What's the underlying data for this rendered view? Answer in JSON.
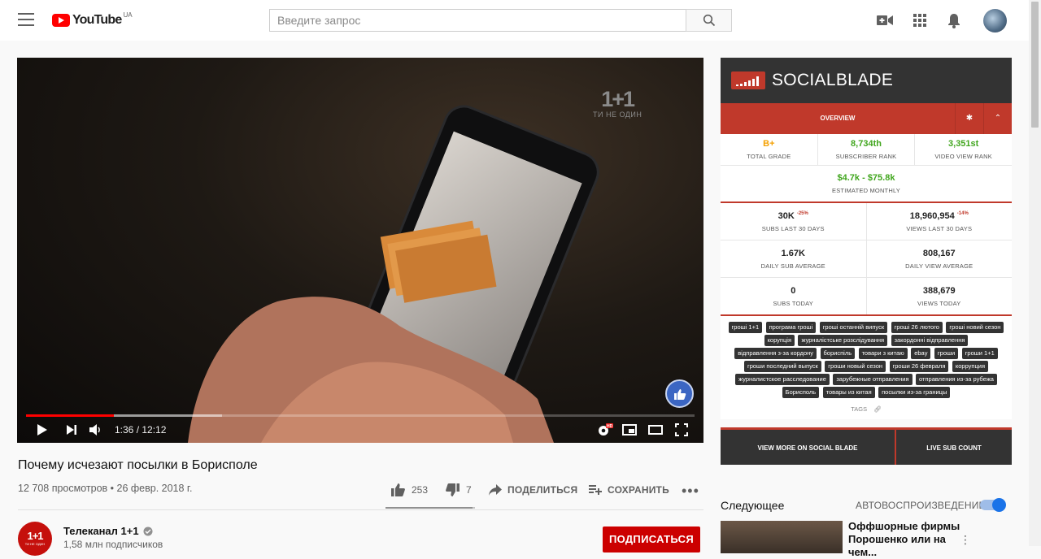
{
  "header": {
    "logo_text": "YouTube",
    "region": "UA",
    "search_placeholder": "Введите запрос",
    "icons": [
      "menu-icon",
      "search-icon",
      "video-camera-icon",
      "apps-grid-icon",
      "bell-icon"
    ]
  },
  "player": {
    "channel_bug": "1+1",
    "channel_bug_sub": "ТИ НЕ ОДИН",
    "current_time": "1:36",
    "duration": "12:12",
    "time_text": "1:36 / 12:12",
    "played_fraction": 0.131,
    "buffered_fraction": 0.293
  },
  "video": {
    "title": "Почему исчезают посылки в Борисполе",
    "meta": "12 708 просмотров • 26 февр. 2018 г.",
    "likes": "253",
    "dislikes": "7",
    "share_label": "ПОДЕЛИТЬСЯ",
    "save_label": "СОХРАНИТЬ",
    "like_ratio": 0.973
  },
  "channel": {
    "avatar_text": "1+1",
    "avatar_sub": "ТИ НЕ ОДИН",
    "name": "Телеканал 1+1",
    "subs": "1,58 млн подписчиков",
    "subscribe_label": "ПОДПИСАТЬСЯ"
  },
  "socialblade": {
    "brand": "SOCIALBLADE",
    "tab_overview": "OVERVIEW",
    "grade": {
      "value": "B+",
      "label": "TOTAL GRADE"
    },
    "subscriber_rank": {
      "value": "8,734th",
      "label": "SUBSCRIBER RANK"
    },
    "video_view_rank": {
      "value": "3,351st",
      "label": "VIDEO VIEW RANK"
    },
    "estimated": {
      "value": "$4.7k - $75.8k",
      "label": "ESTIMATED MONTHLY"
    },
    "subs_30": {
      "value": "30K",
      "delta": "-25%",
      "label": "SUBS LAST 30 DAYS"
    },
    "views_30": {
      "value": "18,960,954",
      "delta": "-14%",
      "label": "VIEWS LAST 30 DAYS"
    },
    "daily_sub": {
      "value": "1.67K",
      "label": "DAILY SUB AVERAGE"
    },
    "daily_view": {
      "value": "808,167",
      "label": "DAILY VIEW AVERAGE"
    },
    "subs_today": {
      "value": "0",
      "label": "SUBS TODAY"
    },
    "views_today": {
      "value": "388,679",
      "label": "VIEWS TODAY"
    },
    "tags": [
      "гроші 1+1",
      "програма гроші",
      "гроші останній випуск",
      "гроші 26 лютого",
      "гроші новий сезон",
      "корупція",
      "журналістське розслідування",
      "закордонні відправлення",
      "відправлення з-за кордону",
      "бориспіль",
      "товари з китаю",
      "ebay",
      "гроши",
      "гроши 1+1",
      "гроши последний выпуск",
      "гроши новый сезон",
      "гроши 26 февраля",
      "коррупция",
      "журналистское расследование",
      "зарубежные отправления",
      "отправления из-за рубежа",
      "Борисполь",
      "товары из китая",
      "посылки из-за границы"
    ],
    "tags_label": "TAGS",
    "view_more": "VIEW MORE ON SOCIAL BLADE",
    "live_sub": "LIVE SUB COUNT"
  },
  "sidebar": {
    "up_next": "Следующее",
    "autoplay": "АВТОВОСПРОИЗВЕДЕНИЕ",
    "autoplay_on": true,
    "next_title": "Оффшорные фирмы Порошенко или на чем..."
  },
  "colors": {
    "youtube_red": "#ff0000",
    "subscribe_red": "#cc0000",
    "socialblade_red": "#c0392b",
    "socialblade_dark": "#333333",
    "stat_green": "#41a61e",
    "grade_orange": "#f4a000",
    "toggle_blue": "#1a73e8"
  }
}
